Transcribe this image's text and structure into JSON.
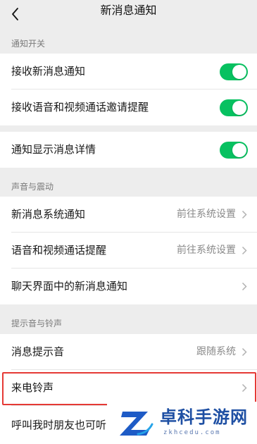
{
  "nav": {
    "title": "新消息通知",
    "back_icon": "chevron-left-icon"
  },
  "sections": {
    "notify_switch": "通知开关",
    "sound_vibration": "声音与震动",
    "tones": "提示音与铃声"
  },
  "rows": {
    "receive_new_messages": {
      "label": "接收新消息通知",
      "toggle_on": true
    },
    "receive_call_invites": {
      "label": "接收语音和视频通话邀请提醒",
      "toggle_on": true
    },
    "show_message_details": {
      "label": "通知显示消息详情",
      "toggle_on": true
    },
    "system_notifications": {
      "label": "新消息系统通知",
      "value": "前往系统设置"
    },
    "call_reminders": {
      "label": "语音和视频通话提醒",
      "value": "前往系统设置"
    },
    "in_chat_notifications": {
      "label": "聊天界面中的新消息通知"
    },
    "message_tone": {
      "label": "消息提示音",
      "value": "跟随系统"
    },
    "ringtone": {
      "label": "来电铃声"
    },
    "friend_ringtone": {
      "label": "呼叫我时朋友也可听"
    }
  },
  "watermark": {
    "name": "卓科手游网",
    "domain": "zkhcedu.com"
  },
  "colors": {
    "toggle_on": "#07c160",
    "highlight": "#e53935",
    "background": "#ededed",
    "watermark": "#1e4fa3"
  }
}
